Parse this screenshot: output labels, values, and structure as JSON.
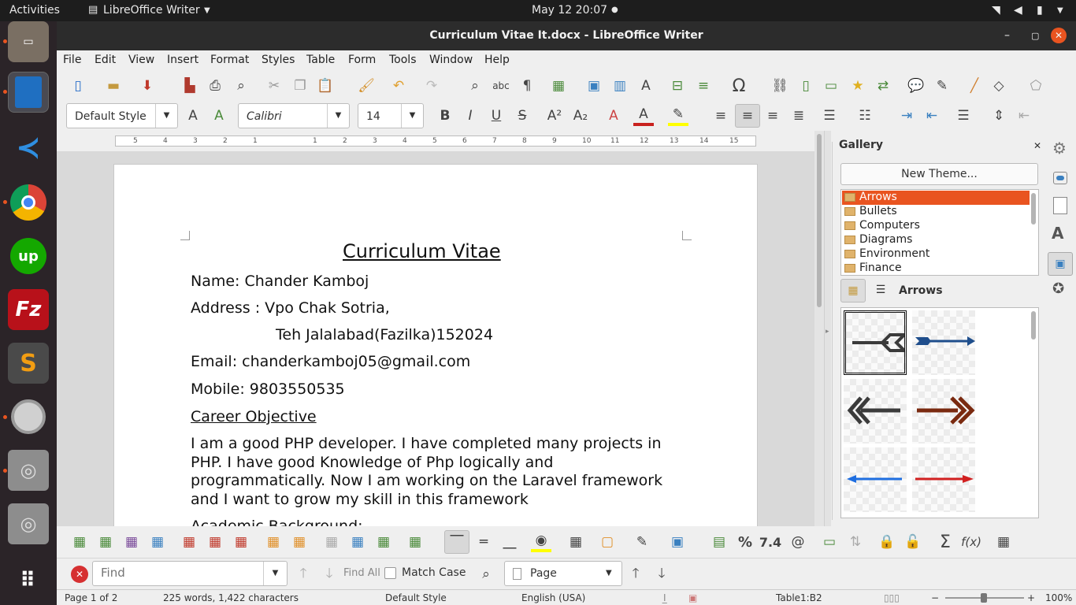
{
  "topbar": {
    "activities": "Activities",
    "app": "LibreOffice Writer",
    "clock": "May 12  20:07"
  },
  "window": {
    "title": "Curriculum Vitae It.docx - LibreOffice Writer"
  },
  "menu": [
    "File",
    "Edit",
    "View",
    "Insert",
    "Format",
    "Styles",
    "Table",
    "Form",
    "Tools",
    "Window",
    "Help"
  ],
  "formatting": {
    "style": "Default Style",
    "font": "Calibri",
    "size": "14"
  },
  "ruler": {
    "ticks": [
      "5",
      "4",
      "3",
      "2",
      "1",
      "1",
      "2",
      "3",
      "4",
      "5",
      "6",
      "7",
      "8",
      "9",
      "10",
      "11",
      "12",
      "13",
      "14",
      "15"
    ]
  },
  "document": {
    "title": "Curriculum Vitae",
    "name": "Name: Chander Kamboj",
    "address1": "Address : Vpo Chak Sotria,",
    "address2": "Teh Jalalabad(Fazilka)152024",
    "email": "Email:  chanderkamboj05@gmail.com",
    "mobile": "Mobile: 9803550535",
    "career_heading": "Career Objective",
    "career_lines": [
      "I am a good PHP developer. I have completed many projects in",
      "PHP. I have good Knowledge of Php logically and",
      "programmatically. Now I am working on the Laravel framework",
      "and I want to grow my skill in this framework"
    ],
    "academic_heading": "Academic Background:"
  },
  "gallery": {
    "title": "Gallery",
    "new_theme": "New Theme...",
    "themes": [
      "Arrows",
      "Bullets",
      "Computers",
      "Diagrams",
      "Environment",
      "Finance"
    ],
    "selected_theme": "Arrows",
    "current_label": "Arrows"
  },
  "findbar": {
    "placeholder": "Find",
    "find_all": "Find All",
    "match_case": "Match Case",
    "page": "Page"
  },
  "tabletoolbar": {
    "percent": "%",
    "number": "7.4",
    "sum": "Σ",
    "fx": "f(x)"
  },
  "status": {
    "page": "Page 1 of 2",
    "words": "225 words, 1,422 characters",
    "style": "Default Style",
    "lang": "English (USA)",
    "cell": "Table1:B2",
    "zoom": "100%"
  },
  "colors": {
    "accent": "#e95420",
    "dock": "#2b2428",
    "titlebar": "#2c2c2c",
    "font_color": "#c9211e",
    "highlight": "#ffff00"
  }
}
